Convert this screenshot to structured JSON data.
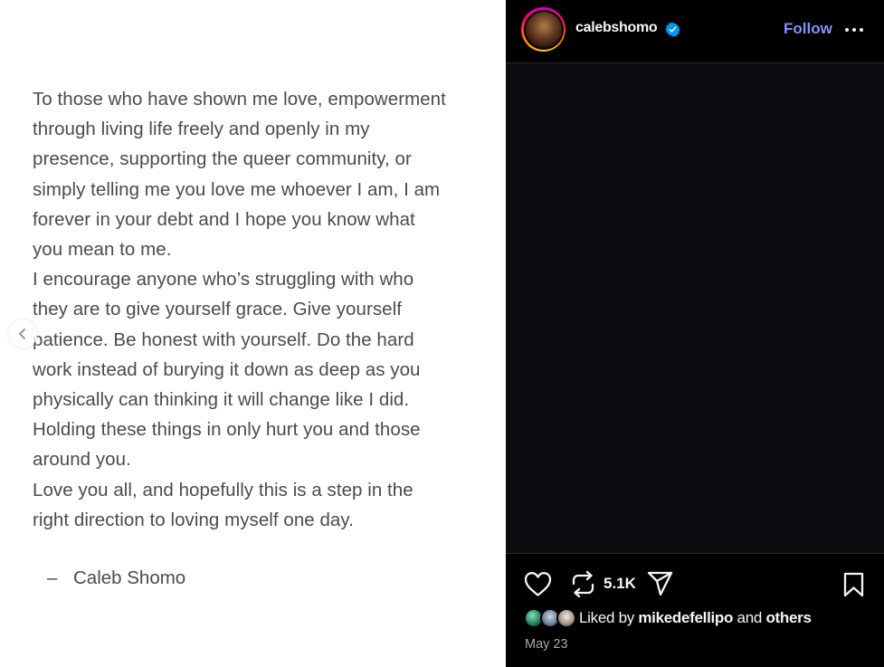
{
  "post": {
    "text_lines": [
      "To those who have shown me love, empowerment",
      "through living life freely and openly in my",
      "presence, supporting the queer community, or",
      "simply telling me you love me whoever I am, I am",
      "forever in your debt and I hope you know what",
      "you mean to me.",
      "I encourage anyone who’s struggling with who",
      "they are to give yourself grace. Give yourself",
      "patience. Be honest with yourself. Do the hard",
      "work instead of burying it down as deep as you",
      "physically can thinking it will change like I did.",
      "Holding these things in only hurt you and those",
      "around you.",
      "Love you all, and hopefully this is a step in the",
      "right direction to loving myself one day."
    ],
    "signature_dash": "–",
    "signature_name": "Caleb Shomo",
    "prev_icon": "chevron-left-icon"
  },
  "header": {
    "username": "calebshomo",
    "verified_icon": "verified-badge-icon",
    "follow_label": "Follow",
    "more_icon": "more-horizontal-icon"
  },
  "actions": {
    "like_icon": "heart-icon",
    "repost_icon": "repost-icon",
    "repost_count": "5.1K",
    "share_icon": "send-icon",
    "save_icon": "bookmark-icon"
  },
  "likes": {
    "prefix": "Liked by",
    "user": "mikedefellipo",
    "conjunction": "and",
    "others": "others"
  },
  "date": "May 23",
  "colors": {
    "panel_bg": "#000000",
    "follow": "#7e93ff",
    "verified": "#0095f6",
    "text_dark": "#4b4b4d"
  }
}
